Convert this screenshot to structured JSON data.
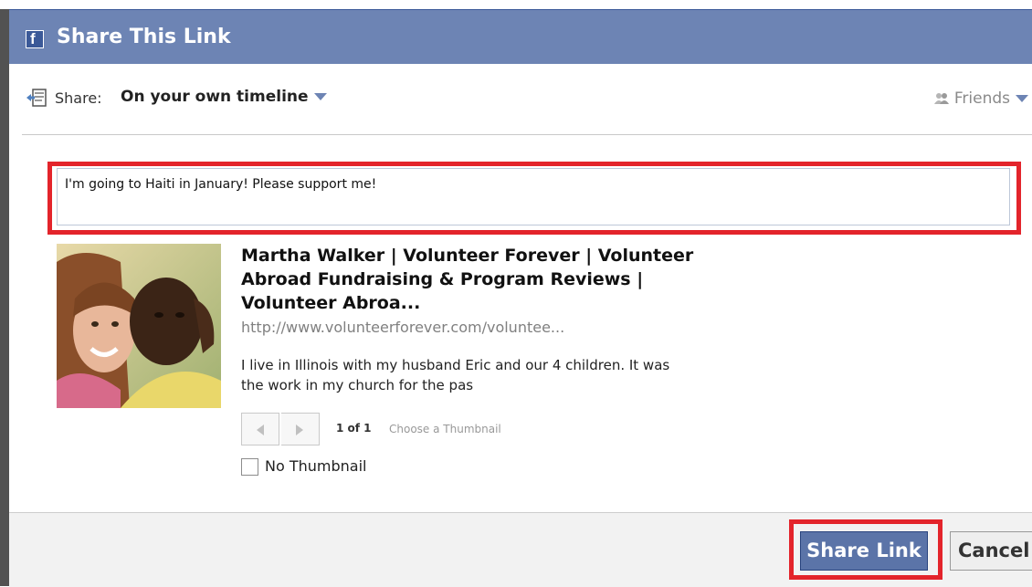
{
  "dialog": {
    "title": "Share This Link",
    "logo_letter": "f"
  },
  "share": {
    "label": "Share:",
    "target": "On your own timeline",
    "privacy": "Friends"
  },
  "composer": {
    "message": "I'm going to Haiti in January! Please support me!"
  },
  "link_preview": {
    "title": "Martha Walker | Volunteer Forever | Volunteer Abroad Fundraising & Program Reviews | Volunteer Abroa...",
    "url": "http://www.volunteerforever.com/voluntee...",
    "description": "I live in Illinois with my husband Eric and our 4 children. It was the work in my church for the pas"
  },
  "thumbnail_picker": {
    "count": "1 of 1",
    "choose_label": "Choose a Thumbnail",
    "no_thumbnail_label": "No Thumbnail"
  },
  "footer": {
    "share_button": "Share Link",
    "cancel_button": "Cancel"
  },
  "colors": {
    "header": "#6d84b4",
    "highlight": "#e3242b",
    "primary_button": "#5b74a8"
  }
}
